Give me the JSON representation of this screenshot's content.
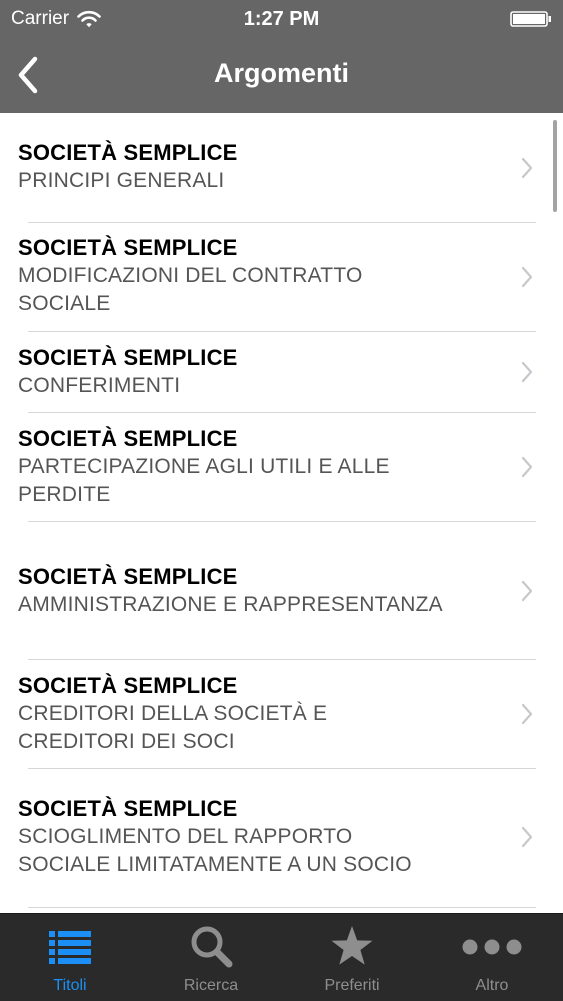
{
  "status_bar": {
    "carrier": "Carrier",
    "time": "1:27 PM"
  },
  "nav": {
    "title": "Argomenti",
    "back_icon": "chevron-left-icon"
  },
  "list": {
    "items": [
      {
        "title": "SOCIETÀ SEMPLICE",
        "subtitle_lines": [
          "PRINCIPI GENERALI"
        ]
      },
      {
        "title": "SOCIETÀ SEMPLICE",
        "subtitle_lines": [
          "MODIFICAZIONI DEL CONTRATTO",
          "SOCIALE"
        ]
      },
      {
        "title": "SOCIETÀ SEMPLICE",
        "subtitle_lines": [
          "CONFERIMENTI"
        ]
      },
      {
        "title": "SOCIETÀ SEMPLICE",
        "subtitle_lines": [
          "PARTECIPAZIONE AGLI UTILI E ALLE",
          "PERDITE"
        ]
      },
      {
        "title": "SOCIETÀ SEMPLICE",
        "subtitle_lines": [
          "AMMINISTRAZIONE E RAPPRESENTANZA"
        ]
      },
      {
        "title": "SOCIETÀ SEMPLICE",
        "subtitle_lines": [
          "CREDITORI DELLA SOCIETÀ E",
          "CREDITORI DEI SOCI"
        ]
      },
      {
        "title": "SOCIETÀ SEMPLICE",
        "subtitle_lines": [
          "SCIOGLIMENTO DEL RAPPORTO",
          "SOCIALE LIMITATAMENTE A UN SOCIO"
        ]
      }
    ]
  },
  "tab_bar": {
    "active_color": "#1b8ff5",
    "inactive_color": "#8e8e8e",
    "tabs": [
      {
        "label": "Titoli",
        "icon": "list-icon",
        "active": true
      },
      {
        "label": "Ricerca",
        "icon": "search-icon",
        "active": false
      },
      {
        "label": "Preferiti",
        "icon": "star-icon",
        "active": false
      },
      {
        "label": "Altro",
        "icon": "more-icon",
        "active": false
      }
    ]
  },
  "colors": {
    "nav_background": "#666666",
    "tab_bar_background": "#2a2a2a"
  }
}
